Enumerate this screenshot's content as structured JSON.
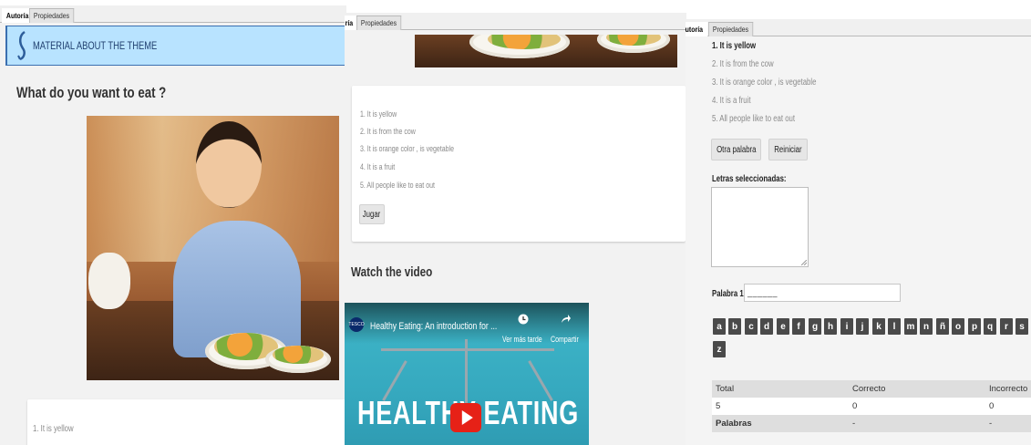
{
  "tabs": {
    "authoring": "Autoría",
    "authoring_clipped": "ría",
    "authoring_clipped2": "utoría",
    "properties": "Propiedades"
  },
  "left": {
    "header": "MATERIAL ABOUT THE THEME",
    "heading": "What do you want to eat ?",
    "clue1": "1. It is yellow"
  },
  "middle": {
    "clues": [
      "1. It is yellow",
      "2. It is from the cow",
      "3. It is orange color , is vegetable",
      "4. It is a fruit",
      "5. All people like to eat out"
    ],
    "play_button": "Jugar",
    "video_heading": "Watch the video",
    "video": {
      "channel": "TESCO",
      "title": "Healthy Eating: An introduction for ...",
      "watch_later": "Ver más tarde",
      "share": "Compartir",
      "overlay_text": "HEALTHY EATING"
    }
  },
  "right": {
    "clues": [
      "1. It is yellow",
      "2. It is from the cow",
      "3. It is orange color , is vegetable",
      "4. It is a fruit",
      "5. All people like to eat out"
    ],
    "other_word_button": "Otra palabra",
    "restart_button": "Reiniciar",
    "selected_letters_label": "Letras seleccionadas:",
    "word_label": "Palabra 1:",
    "word_value": "_ _ _ _ _ _",
    "letters": [
      "a",
      "b",
      "c",
      "d",
      "e",
      "f",
      "g",
      "h",
      "i",
      "j",
      "k",
      "l",
      "m",
      "n",
      "ñ",
      "o",
      "p",
      "q",
      "r",
      "s",
      "z"
    ],
    "table": {
      "headers": [
        "Total",
        "Correcto",
        "Incorrecto"
      ],
      "row1": [
        "5",
        "0",
        "0"
      ],
      "row2": [
        "Palabras",
        "-",
        "-"
      ]
    }
  },
  "colors": {
    "header_bg": "#b8e3ff",
    "header_border": "#3b6fb0",
    "letter_bg": "#4a4a4a",
    "play_red": "#e62117",
    "video_teal": "#3fb7c9"
  }
}
